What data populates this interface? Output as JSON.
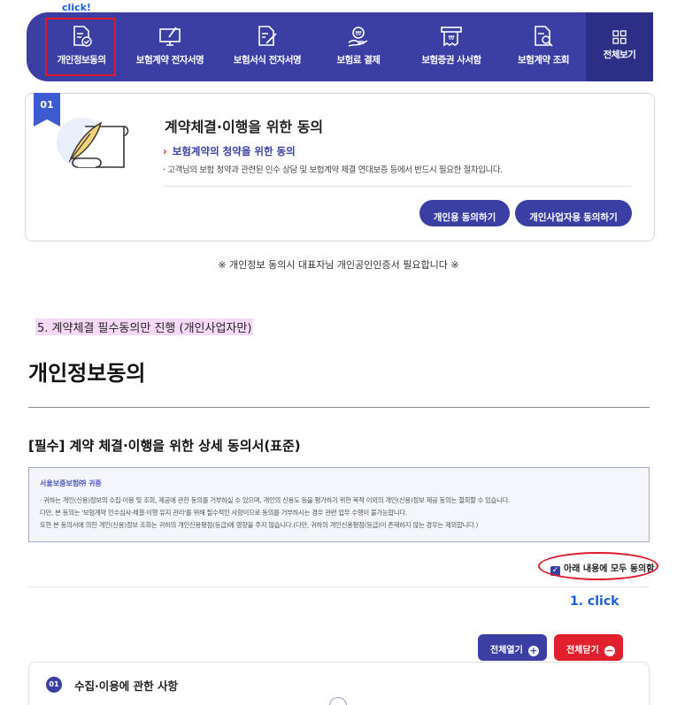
{
  "top_annotation": "click!",
  "nav": {
    "items": [
      {
        "label": "개인정보동의",
        "icon": "document-check-icon"
      },
      {
        "label": "보험계약 전자서명",
        "icon": "monitor-pen-icon"
      },
      {
        "label": "보험서식 전자서명",
        "icon": "document-pen-icon"
      },
      {
        "label": "보험료 결제",
        "icon": "hand-coin-icon"
      },
      {
        "label": "보험증권 사서함",
        "icon": "receipt-icon"
      },
      {
        "label": "보험계약 조회",
        "icon": "document-search-icon"
      }
    ],
    "all_label": "전체보기"
  },
  "card": {
    "badge": "01",
    "title": "계약체결·이행을 위한 동의",
    "subtitle": "보험계약의 청약을 위한 동의",
    "description": "· 고객님의 보험 청약과 관련된 인수 상담 및 보험계약 체결 연대보증 등에서 반드시 필요한 절차입니다.",
    "btn_personal": "개인용 동의하기",
    "btn_business": "개인사업자용 동의하기"
  },
  "notice": "※ 개인정보 동의시 대표자님 개인공인인증서 필요합니다 ※",
  "step5": "5. 계약체결 필수동의만 진행 (개인사업자만)",
  "page_title": "개인정보동의",
  "section_title": "[필수] 계약 체결·이행을 위한 상세 동의서(표준)",
  "info": {
    "head": "서울보증보험㈜ 귀중",
    "lines": [
      "· 귀하는 개인(신용)정보의 수집·이용 및 조회, 제공에 관한 동의를 거부하실 수 있으며, 개인의 신용도 등을 평가하기 위한 목적 이외의 개인(신용)정보 제공 동의는 철회할 수 있습니다.",
      "  다만, 본 동의는 '보험계약 인수심사·체결·이행 유지 관리'를 위해 필수적인 사항이므로 동의를 거부하시는 경우 관련 업무 수행이 불가능합니다.",
      "  또한 본 동의서에 의한 개인(신용)정보 조회는 귀하의 개인신용평점(등급)에 영향을 주지 않습니다.(다만, 귀하의 개인신용평점(등급)이 존재하지 않는 경우는 제외합니다.)"
    ]
  },
  "agree_all": "아래 내용에 모두 동의함",
  "click_annotation": "1. click",
  "btn_open_all": "전체열기",
  "btn_close_all": "전체닫기",
  "accordion": {
    "num": "01",
    "title": "수집·이용에 관한 사항"
  }
}
